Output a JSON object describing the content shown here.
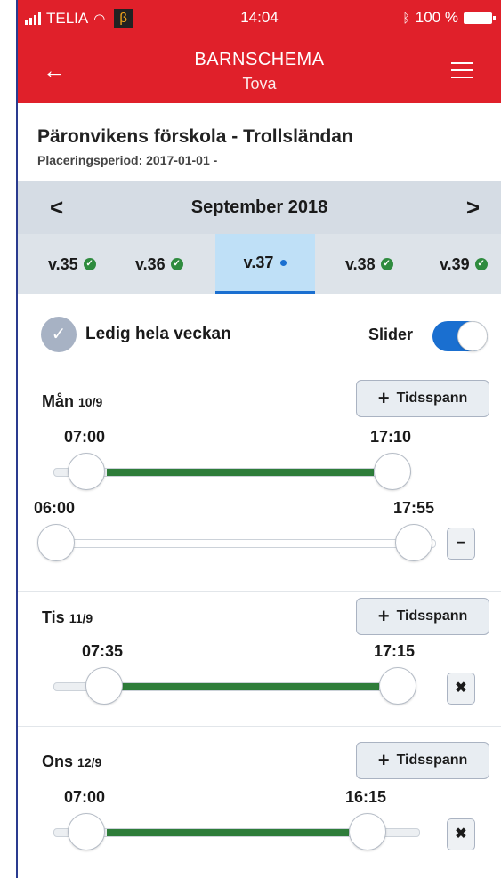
{
  "status": {
    "carrier": "TELIA",
    "beta": "β",
    "time": "14:04",
    "battery": "100 %"
  },
  "header": {
    "title": "BARNSCHEMA",
    "subtitle": "Tova",
    "back_icon": "←",
    "menu_icon": "hamburger-icon"
  },
  "school": {
    "name": "Päronvikens förskola - Trollsländan",
    "period": "Placeringsperiod: 2017-01-01 -"
  },
  "calendar": {
    "month": "September 2018",
    "prev": "<",
    "next": ">",
    "weeks": [
      {
        "label": "v.35",
        "status": "check"
      },
      {
        "label": "v.36",
        "status": "check"
      },
      {
        "label": "v.37",
        "status": "active"
      },
      {
        "label": "v.38",
        "status": "check"
      },
      {
        "label": "v.39",
        "status": "check"
      }
    ]
  },
  "options": {
    "ledig": "Ledig hela veckan",
    "slider": "Slider",
    "slider_on": true
  },
  "add_label": "Tidsspann",
  "days": [
    {
      "label": "Mån",
      "date": "10/9",
      "start": "07:00",
      "end": "17:10",
      "range_start": "06:00",
      "range_end": "17:55"
    },
    {
      "label": "Tis",
      "date": "11/9",
      "start": "07:35",
      "end": "17:15"
    },
    {
      "label": "Ons",
      "date": "12/9",
      "start": "07:00",
      "end": "16:15"
    }
  ],
  "icons": {
    "minus": "−",
    "close": "✖"
  }
}
